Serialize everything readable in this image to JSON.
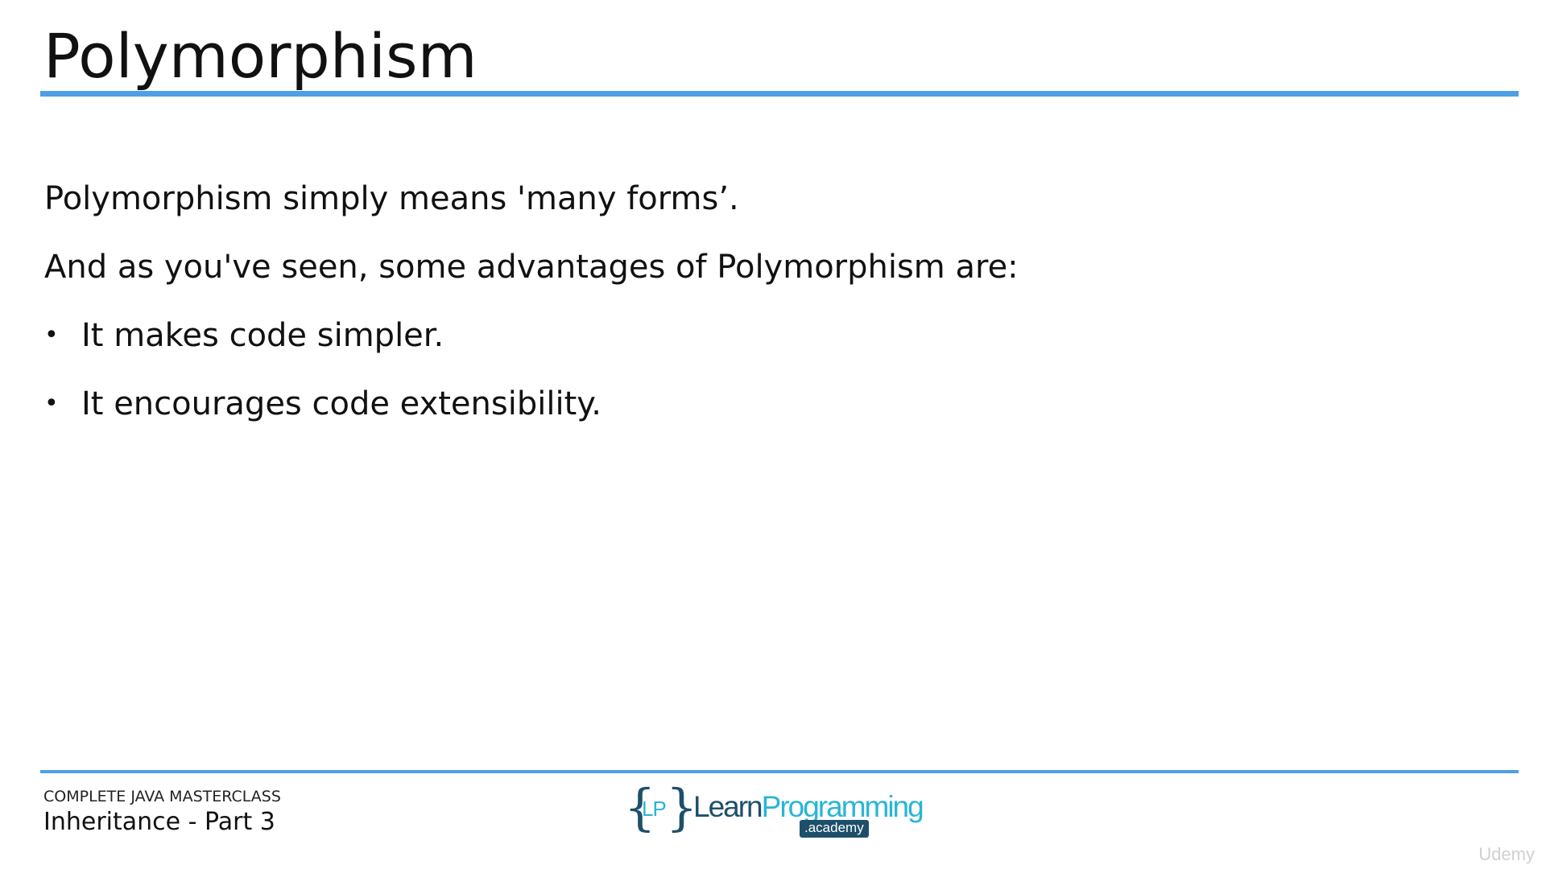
{
  "slide": {
    "title": "Polymorphism",
    "paragraphs": [
      "Polymorphism simply means 'many forms’.",
      "And as you've seen, some advantages of Polymorphism are:"
    ],
    "bullets": [
      "It makes code simpler.",
      "It encourages code extensibility."
    ],
    "bullet_glyph": "•"
  },
  "footer": {
    "course": "COMPLETE JAVA MASTERCLASS",
    "lecture": "Inheritance - Part 3"
  },
  "logo": {
    "brace_open": "{",
    "brace_close": "}",
    "mark": "LP",
    "learn": "Learn",
    "programming": "Programming",
    "academy": ".academy"
  },
  "watermark": "Udemy",
  "colors": {
    "accent_rule": "#4f9fe6",
    "logo_dark": "#1d4f6b",
    "logo_light": "#29b5d6",
    "text": "#111111"
  }
}
